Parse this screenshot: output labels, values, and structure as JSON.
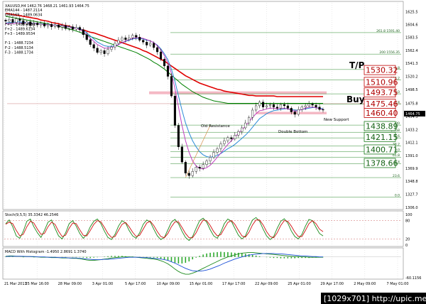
{
  "symbol_line": "XAUUSD,H4 1462.76 1468.21 1461.93 1464.75",
  "indicator_info": [
    "EMA144 - 1487.2114",
    "EMA169 - 1489.0634",
    "",
    "F+1 - 1489.4034",
    "F+2 - 1489.6134",
    "F+3 - 1489.9534",
    "",
    "F-1 - 1488.7234",
    "F-2 - 1488.5134",
    "F-3 - 1488.1734"
  ],
  "current_price": "1464.75",
  "annotations": {
    "tp": "T/P",
    "buy": "Buy",
    "old_resistance": "Old Resistance",
    "double_bottom": "Double Bottom",
    "new_support": "New Support"
  },
  "resistance_levels": [
    {
      "label": "1530.32",
      "price": 1530.32
    },
    {
      "label": "1510.96",
      "price": 1510.96
    },
    {
      "label": "1493.75",
      "price": 1493.75
    },
    {
      "label": "1475.46",
      "price": 1475.46
    },
    {
      "label": "1460.40",
      "price": 1460.4
    }
  ],
  "support_levels": [
    {
      "label": "1438.89",
      "price": 1438.89
    },
    {
      "label": "1421.15",
      "price": 1421.15
    },
    {
      "label": "1400.71",
      "price": 1400.71
    },
    {
      "label": "1378.66",
      "price": 1378.66
    }
  ],
  "fib_labels": [
    {
      "label": "261.8 1591.40",
      "price": 1591.4
    },
    {
      "label": "200 1556.35",
      "price": 1556.35
    },
    {
      "label": "161.8",
      "price": 1531.2
    },
    {
      "label": "138.2",
      "price": 1514.5
    },
    {
      "label": "100.0",
      "price": 1491.5
    },
    {
      "label": "76.4",
      "price": 1474.8
    },
    {
      "label": "100",
      "price": 1440.5
    },
    {
      "label": "14.58",
      "price": 1428.8
    },
    {
      "label": "23.6",
      "price": 1419.6
    },
    {
      "label": "38.2",
      "price": 1406.2
    },
    {
      "label": "50.0",
      "price": 1397.2
    },
    {
      "label": "61.8",
      "price": 1388.2
    },
    {
      "label": "76.4",
      "price": 1377.4
    },
    {
      "label": "23.6",
      "price": 1354.8
    },
    {
      "label": "0.0",
      "price": 1323.0
    }
  ],
  "stoch_info": "Stoch(9,5,5) 35.3342 46.2546",
  "macd_info": "MACD With Histogram -1.4950 2.8691 1.3740",
  "watermark": "[1029x701] http://upic.me/",
  "chart_data": [
    {
      "type": "line",
      "panel": "price",
      "title": "XAUUSD,H4",
      "ylim": [
        1305,
        1640
      ],
      "y_ticks": [
        1625.5,
        1604.6,
        1583.5,
        1562.4,
        1541.3,
        1520.2,
        1498.5,
        1475.8,
        1454.3,
        1433.2,
        1412.1,
        1391.0,
        1369.9,
        1348.8,
        1327.7,
        1306.0
      ],
      "x_labels": [
        "21 Mar 2013",
        "25 Mar 16:00",
        "28 Mar 09:00",
        "3 Apr 01:00",
        "5 Apr 17:00",
        "10 Apr 09:00",
        "15 Apr 01:00",
        "17 Apr 17:00",
        "22 Apr 09:00",
        "25 Apr 01:00",
        "29 Apr 17:00",
        "2 May 09:00",
        "7 May 01:00"
      ],
      "close": [
        1610,
        1613,
        1608,
        1614,
        1611,
        1605,
        1609,
        1603,
        1607,
        1604,
        1606,
        1602,
        1605,
        1601,
        1604,
        1600,
        1603,
        1598,
        1601,
        1597,
        1600,
        1596,
        1588,
        1580,
        1572,
        1566,
        1559,
        1562,
        1557,
        1564,
        1568,
        1574,
        1579,
        1583,
        1580,
        1583,
        1587,
        1584,
        1579,
        1576,
        1571,
        1574,
        1567,
        1560,
        1548,
        1537,
        1520,
        1488,
        1440,
        1405,
        1380,
        1362,
        1358,
        1365,
        1372,
        1370,
        1376,
        1382,
        1388,
        1396,
        1402,
        1410,
        1415,
        1420,
        1418,
        1424,
        1430,
        1436,
        1444,
        1453,
        1465,
        1472,
        1478,
        1470,
        1472,
        1474,
        1470,
        1468,
        1474,
        1472,
        1468,
        1462,
        1458,
        1466,
        1470,
        1472,
        1475,
        1473,
        1470,
        1466,
        1465
      ],
      "series": [
        {
          "name": "EMA144",
          "color": "#e00000",
          "values": [
            1623,
            1622,
            1621,
            1620,
            1619,
            1618,
            1617,
            1616,
            1615,
            1614,
            1612,
            1611,
            1610,
            1608,
            1607,
            1606,
            1604,
            1603,
            1602,
            1600,
            1599,
            1597,
            1596,
            1594,
            1592,
            1591,
            1589,
            1587,
            1585,
            1583,
            1581,
            1579,
            1577,
            1575,
            1573,
            1571,
            1569,
            1567,
            1565,
            1562,
            1560,
            1557,
            1554,
            1551,
            1548,
            1545,
            1541,
            1537,
            1533,
            1529,
            1525,
            1521,
            1518,
            1515,
            1512,
            1509,
            1507,
            1505,
            1503,
            1501,
            1499,
            1498,
            1496,
            1495,
            1494,
            1493,
            1492,
            1491,
            1490,
            1489,
            1489,
            1488,
            1488,
            1488,
            1488,
            1488,
            1488,
            1487,
            1487,
            1487,
            1487,
            1487,
            1487,
            1487,
            1487,
            1487,
            1487,
            1487,
            1487,
            1487,
            1487
          ]
        },
        {
          "name": "EMA169",
          "color": "#008000",
          "values": [
            1618,
            1617,
            1616,
            1615,
            1614,
            1613,
            1612,
            1611,
            1610,
            1609,
            1608,
            1607,
            1606,
            1604,
            1603,
            1602,
            1600,
            1599,
            1597,
            1596,
            1594,
            1592,
            1590,
            1588,
            1585,
            1583,
            1581,
            1579,
            1577,
            1575,
            1573,
            1571,
            1569,
            1567,
            1565,
            1563,
            1561,
            1559,
            1556,
            1553,
            1550,
            1547,
            1543,
            1540,
            1536,
            1532,
            1527,
            1522,
            1517,
            1512,
            1507,
            1503,
            1499,
            1495,
            1492,
            1489,
            1486,
            1484,
            1482,
            1480,
            1479,
            1478,
            1477,
            1476,
            1476,
            1476,
            1476,
            1476,
            1476,
            1476,
            1476,
            1476,
            1476,
            1476,
            1476,
            1476,
            1476,
            1476,
            1476,
            1476,
            1476,
            1476,
            1476,
            1476,
            1476,
            1476,
            1476,
            1476,
            1476,
            1476,
            1476
          ]
        },
        {
          "name": "Fast MA",
          "color": "#2a8bd6",
          "values": [
            1607,
            1608,
            1608,
            1609,
            1609,
            1608,
            1608,
            1607,
            1607,
            1606,
            1606,
            1605,
            1605,
            1604,
            1604,
            1603,
            1603,
            1602,
            1601,
            1600,
            1599,
            1598,
            1595,
            1591,
            1586,
            1581,
            1576,
            1573,
            1570,
            1569,
            1569,
            1570,
            1572,
            1575,
            1577,
            1579,
            1581,
            1582,
            1582,
            1581,
            1579,
            1578,
            1575,
            1571,
            1565,
            1557,
            1547,
            1532,
            1512,
            1488,
            1465,
            1444,
            1428,
            1415,
            1405,
            1397,
            1392,
            1389,
            1388,
            1389,
            1391,
            1394,
            1398,
            1402,
            1405,
            1409,
            1414,
            1419,
            1424,
            1430,
            1437,
            1444,
            1451,
            1455,
            1459,
            1462,
            1464,
            1465,
            1466,
            1467,
            1467,
            1466,
            1465,
            1465,
            1466,
            1467,
            1468,
            1469,
            1469,
            1468,
            1467
          ]
        },
        {
          "name": "Slow MA",
          "color": "#c040c0",
          "values": [
            1606,
            1606,
            1606,
            1607,
            1607,
            1607,
            1607,
            1606,
            1606,
            1606,
            1605,
            1605,
            1604,
            1604,
            1603,
            1603,
            1602,
            1601,
            1600,
            1599,
            1598,
            1597,
            1593,
            1588,
            1582,
            1577,
            1572,
            1569,
            1566,
            1566,
            1567,
            1569,
            1572,
            1575,
            1578,
            1580,
            1582,
            1583,
            1583,
            1582,
            1580,
            1578,
            1575,
            1570,
            1563,
            1554,
            1542,
            1525,
            1500,
            1470,
            1440,
            1415,
            1396,
            1382,
            1374,
            1370,
            1369,
            1371,
            1375,
            1381,
            1388,
            1395,
            1402,
            1409,
            1415,
            1421,
            1427,
            1433,
            1439,
            1446,
            1453,
            1459,
            1464,
            1465,
            1467,
            1468,
            1468,
            1467,
            1468,
            1468,
            1467,
            1465,
            1463,
            1464,
            1466,
            1468,
            1470,
            1470,
            1469,
            1467,
            1466
          ]
        }
      ]
    },
    {
      "type": "line",
      "panel": "stochastic",
      "title": "Stoch(9,5,5)",
      "ylim": [
        0,
        100
      ],
      "y_ticks": [
        100,
        80,
        20,
        0
      ],
      "series": [
        {
          "name": "%K",
          "color": "#1a8a1a",
          "values": [
            70,
            82,
            60,
            30,
            22,
            45,
            78,
            85,
            60,
            40,
            25,
            48,
            75,
            82,
            55,
            30,
            20,
            40,
            70,
            80,
            62,
            38,
            22,
            35,
            60,
            78,
            85,
            70,
            45,
            25,
            18,
            35,
            62,
            80,
            72,
            48,
            30,
            22,
            40,
            68,
            82,
            76,
            52,
            30,
            18,
            25,
            50,
            75,
            84,
            70,
            45,
            25,
            15,
            28,
            55,
            80,
            88,
            75,
            50,
            30,
            22,
            42,
            70,
            85,
            78,
            55,
            32,
            20,
            30,
            58,
            82,
            90,
            78,
            52,
            30,
            18,
            28,
            55,
            78,
            86,
            72,
            46,
            28,
            20,
            35,
            62,
            84,
            80,
            58,
            38,
            30
          ]
        },
        {
          "name": "%D",
          "color": "#d01010",
          "values": [
            68,
            75,
            70,
            48,
            30,
            35,
            60,
            78,
            72,
            52,
            35,
            38,
            60,
            75,
            68,
            45,
            28,
            32,
            55,
            72,
            70,
            50,
            32,
            30,
            48,
            68,
            80,
            76,
            58,
            38,
            25,
            28,
            48,
            68,
            74,
            60,
            42,
            28,
            32,
            52,
            72,
            78,
            64,
            44,
            28,
            24,
            38,
            60,
            76,
            76,
            58,
            38,
            24,
            24,
            40,
            64,
            82,
            80,
            64,
            44,
            30,
            34,
            54,
            74,
            80,
            68,
            48,
            30,
            26,
            42,
            66,
            82,
            82,
            66,
            44,
            28,
            24,
            40,
            64,
            80,
            78,
            62,
            42,
            28,
            28,
            48,
            70,
            80,
            70,
            52,
            44
          ]
        }
      ]
    },
    {
      "type": "area",
      "panel": "macd",
      "title": "MACD With Histogram",
      "ylim": [
        -60.1156,
        20
      ],
      "y_ticks": [
        -60.1156
      ],
      "series": [
        {
          "name": "MACD",
          "color": "#1a8a1a",
          "values": [
            2,
            3,
            3,
            2,
            2,
            1,
            1,
            1,
            0,
            0,
            -1,
            -1,
            -1,
            -2,
            -2,
            -2,
            -3,
            -3,
            -3,
            -4,
            -4,
            -5,
            -7,
            -9,
            -10,
            -10,
            -9,
            -8,
            -6,
            -5,
            -3,
            -2,
            -1,
            0,
            0,
            0,
            0,
            -1,
            -2,
            -3,
            -4,
            -5,
            -6,
            -8,
            -11,
            -15,
            -20,
            -27,
            -35,
            -42,
            -47,
            -50,
            -50,
            -47,
            -43,
            -38,
            -33,
            -28,
            -23,
            -18,
            -13,
            -8,
            -4,
            0,
            3,
            6,
            9,
            11,
            12,
            13,
            13,
            12,
            11,
            10,
            9,
            8,
            7,
            6,
            5,
            4,
            3,
            2,
            1,
            1,
            0,
            0,
            -1,
            -1,
            -1,
            -1,
            -1
          ]
        },
        {
          "name": "Signal",
          "color": "#1a4fd6",
          "values": [
            1,
            2,
            2,
            2,
            2,
            2,
            1,
            1,
            1,
            0,
            0,
            0,
            -1,
            -1,
            -1,
            -2,
            -2,
            -2,
            -3,
            -3,
            -3,
            -4,
            -5,
            -6,
            -7,
            -8,
            -8,
            -8,
            -7,
            -7,
            -6,
            -5,
            -4,
            -3,
            -2,
            -1,
            -1,
            -1,
            -1,
            -2,
            -2,
            -3,
            -4,
            -5,
            -6,
            -8,
            -10,
            -14,
            -18,
            -23,
            -28,
            -33,
            -37,
            -40,
            -41,
            -41,
            -40,
            -38,
            -35,
            -31,
            -27,
            -23,
            -18,
            -14,
            -10,
            -6,
            -3,
            0,
            3,
            5,
            7,
            8,
            9,
            10,
            10,
            10,
            10,
            9,
            9,
            8,
            7,
            6,
            5,
            4,
            3,
            3,
            2,
            1,
            1,
            0,
            0
          ]
        },
        {
          "name": "Histogram",
          "color": "#2faa2f",
          "values": [
            1,
            1,
            1,
            0,
            0,
            -1,
            0,
            0,
            -1,
            0,
            -1,
            -1,
            0,
            -1,
            -1,
            0,
            -1,
            -1,
            0,
            -1,
            -1,
            -1,
            -2,
            -3,
            -3,
            -2,
            -1,
            0,
            1,
            2,
            3,
            3,
            3,
            3,
            2,
            1,
            1,
            0,
            -1,
            -1,
            -2,
            -2,
            -2,
            -3,
            -5,
            -7,
            -10,
            -13,
            -17,
            -19,
            -19,
            -17,
            -13,
            -7,
            -2,
            3,
            7,
            10,
            12,
            13,
            14,
            15,
            14,
            14,
            13,
            12,
            12,
            11,
            9,
            8,
            6,
            4,
            2,
            0,
            -1,
            -2,
            -3,
            -3,
            -4,
            -4,
            -4,
            -4,
            -4,
            -3,
            -3,
            -3,
            -3,
            -2,
            -2,
            -1,
            -1
          ]
        }
      ]
    }
  ]
}
